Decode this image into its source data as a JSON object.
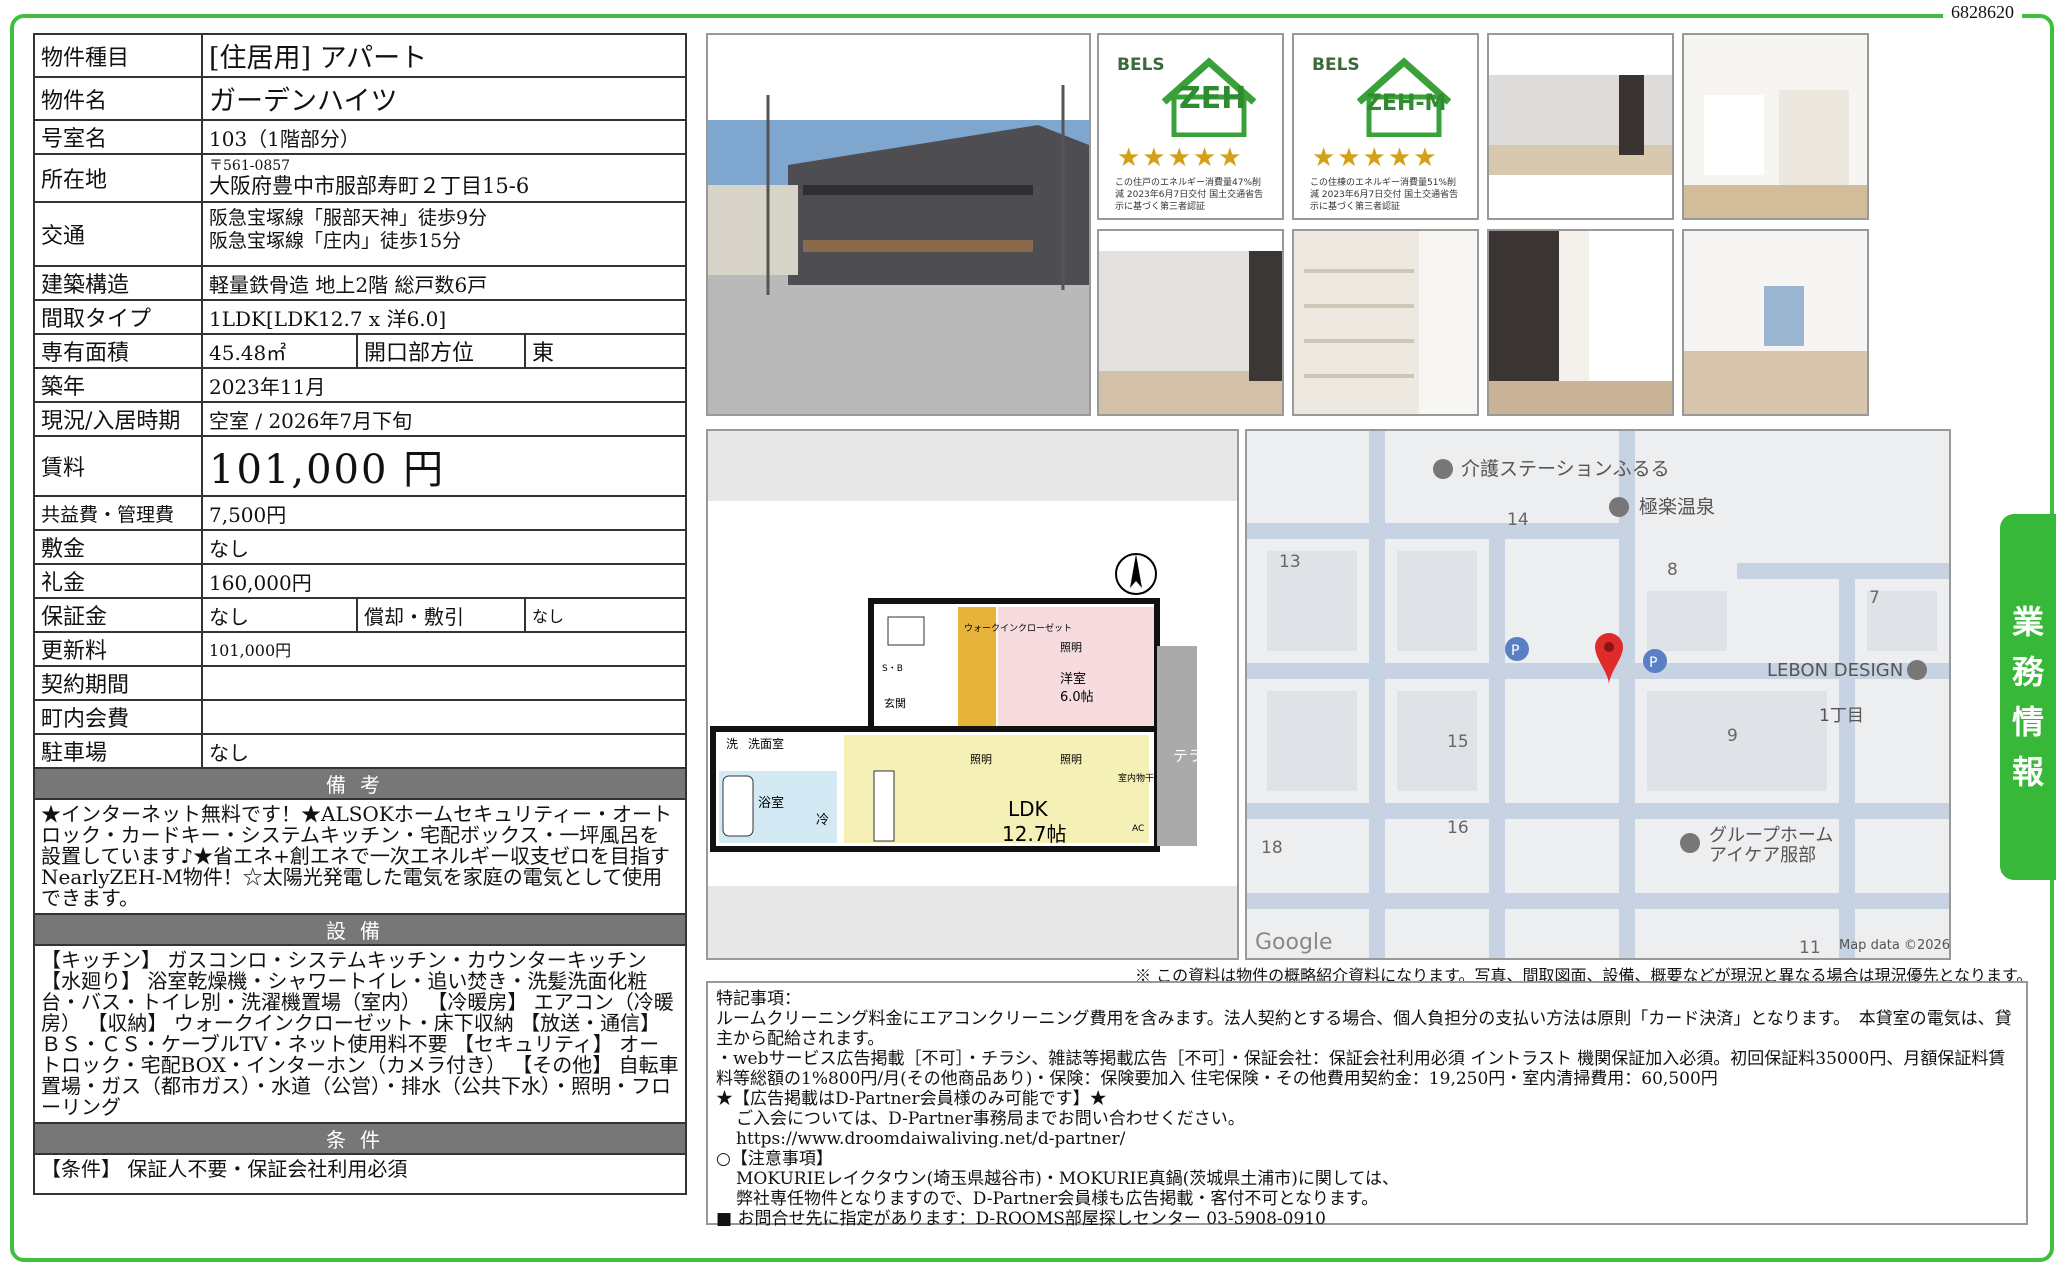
{
  "doc_id": "6828620",
  "side_tab": [
    "業",
    "務",
    "情",
    "報"
  ],
  "table": {
    "type_label": "物件種目",
    "type_value": "[住居用] アパート",
    "name_label": "物件名",
    "name_value": "ガーデンハイツ",
    "room_label": "号室名",
    "room_value": "103（1階部分）",
    "address_label": "所在地",
    "postal": "〒561-0857",
    "address": "大阪府豊中市服部寿町２丁目15-6",
    "traffic_label": "交通",
    "traffic_1": "阪急宝塚線「服部天神」徒歩9分",
    "traffic_2": "阪急宝塚線「庄内」徒歩15分",
    "structure_label": "建築構造",
    "structure_value": "軽量鉄骨造 地上2階 総戸数6戸",
    "layout_label": "間取タイプ",
    "layout_value": "1LDK[LDK12.7 x 洋6.0]",
    "area_label": "専有面積",
    "area_value": "45.48㎡",
    "opening_label": "開口部方位",
    "opening_value": "東",
    "built_label": "築年",
    "built_value": "2023年11月",
    "status_label": "現況/入居時期",
    "status_value": "空室 / 2026年7月下旬",
    "rent_label": "賃料",
    "rent_value": "101,000 円",
    "fee_label": "共益費・管理費",
    "fee_value": "7,500円",
    "deposit_label": "敷金",
    "deposit_value": "なし",
    "key_money_label": "礼金",
    "key_money_value": "160,000円",
    "guarantee_label": "保証金",
    "guarantee_value": "なし",
    "amort_label": "償却・敷引",
    "amort_value": "なし",
    "renewal_label": "更新料",
    "renewal_value": "101,000円",
    "contract_label": "契約期間",
    "contract_value": "",
    "community_label": "町内会費",
    "community_value": "",
    "parking_label": "駐車場",
    "parking_value": "なし"
  },
  "remarks_head": "備考",
  "remarks_text": "★インターネット無料です！★ALSOKホームセキュリティー・オートロック・カードキー・システムキッチン・宅配ボックス・一坪風呂を設置しています♪★省エネ+創エネで一次エネルギー収支ゼロを目指すNearlyZEH-M物件！☆太陽光発電した電気を家庭の電気として使用できます。",
  "equip_head": "設備",
  "equip_text": "【キッチン】 ガスコンロ・システムキッチン・カウンターキッチン 【水廻り】 浴室乾燥機・シャワートイレ・追い焚き・洗髪洗面化粧台・バス・トイレ別・洗濯機置場（室内） 【冷暖房】 エアコン（冷暖房） 【収納】 ウォークインクローゼット・床下収納 【放送・通信】 ＢＳ・ＣＳ・ケーブルTV・ネット使用料不要 【セキュリティ】 オートロック・宅配BOX・インターホン（カメラ付き） 【その他】 自転車置場・ガス（都市ガス）・水道（公営）・排水（公共下水）・照明・フローリング",
  "cond_head": "条件",
  "cond_text": "【条件】 保証人不要・保証会社利用必須",
  "bels1": {
    "brand": "BELS",
    "mark": "ZEH",
    "caption": "この住戸のエネルギー消費量47%削減 2023年6月7日交付 国土交通省告示に基づく第三者認証"
  },
  "bels2": {
    "brand": "BELS",
    "mark": "ZEH-M",
    "caption": "この住棟のエネルギー消費量51%削減 2023年6月7日交付 国土交通省告示に基づく第三者認証"
  },
  "floorplan": {
    "walkin": "ウォークインクローゼット",
    "light": "照明",
    "western": "洋室",
    "western_size": "6.0帖",
    "terrace": "テラス",
    "washroom": "洗面室",
    "bath": "浴室",
    "wash": "洗",
    "fridge": "冷",
    "entrance": "玄関",
    "shoebox": "S・B",
    "ldk": "LDK",
    "ldk_size": "12.7帖",
    "dryer": "室内物干",
    "ac": "AC"
  },
  "map": {
    "poi_1": "介護ステーションふるる",
    "poi_2": "極楽温泉",
    "poi_3": "LEBON DESIGN",
    "poi_4": "グループホーム",
    "poi_4b": "アイケア服部",
    "chome": "1丁目",
    "n14": "14",
    "n13": "13",
    "n8": "8",
    "n7": "7",
    "n9": "9",
    "n15": "15",
    "n16": "16",
    "n18": "18",
    "n11": "11",
    "google": "Google",
    "mapdata": "Map data ©2026",
    "p": "P"
  },
  "disclaimer": "※ この資料は物件の概略紹介資料になります。写真、間取図面、設備、概要などが現況と異なる場合は現況優先となります。",
  "remarks_box": [
    "特記事項：",
    "ルームクリーニング料金にエアコンクリーニング費用を含みます。法人契約とする場合、個人負担分の支払い方法は原則「カード決済」となります。　本貸室の電気は、貸主から配給されます。",
    "・webサービス広告掲載［不可］・チラシ、雑誌等掲載広告［不可］・保証会社：保証会社利用必須 イントラスト 機関保証加入必須。初回保証料35000円、月額保証料賃料等総額の1%800円/月(その他商品あり)・保険：保険要加入 住宅保険・その他費用契約金：19,250円・室内清掃費用：60,500円",
    "★【広告掲載はD-Partner会員様のみ可能です】★",
    "ご入会については、D-Partner事務局までお問い合わせください。",
    "https://www.droomdaiwaliving.net/d-partner/",
    "○【注意事項】",
    "MOKURIEレイクタウン(埼玉県越谷市)・MOKURIE真鍋(茨城県土浦市)に関しては、",
    "弊社専任物件となりますので、D-Partner会員様も広告掲載・客付不可となります。",
    "■ お問合せ先に指定があります：D-ROOMS部屋探しセンター 03-5908-0910"
  ]
}
